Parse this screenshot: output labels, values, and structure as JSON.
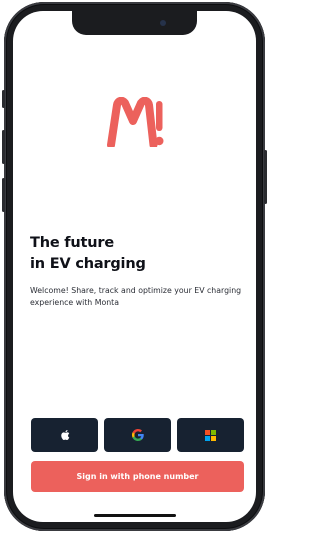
{
  "brand": {
    "logo_name": "monta-logo",
    "accent_color": "#ec615c",
    "dark_button_color": "#172231"
  },
  "welcome": {
    "headline_line1": "The future",
    "headline_line2": "in EV charging",
    "description": "Welcome! Share, track and optimize your EV charging experience with Monta"
  },
  "auth": {
    "social_buttons": [
      {
        "provider": "Apple",
        "icon": "apple-icon"
      },
      {
        "provider": "Google",
        "icon": "google-icon"
      },
      {
        "provider": "Microsoft",
        "icon": "microsoft-icon"
      }
    ],
    "phone_label": "Sign in with phone number"
  }
}
